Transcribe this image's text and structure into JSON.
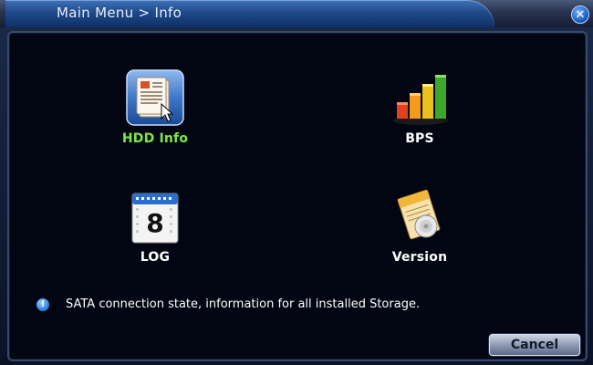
{
  "window": {
    "title": "Main Menu > Info",
    "close_icon": "close-icon"
  },
  "tiles": [
    {
      "label": "HDD Info",
      "icon": "hdd-info-icon",
      "selected": true
    },
    {
      "label": "BPS",
      "icon": "bar-chart-icon",
      "selected": false
    },
    {
      "label": "LOG",
      "icon": "calendar-log-icon",
      "selected": false
    },
    {
      "label": "Version",
      "icon": "version-document-icon",
      "selected": false
    }
  ],
  "info": {
    "icon": "info-icon",
    "text": "SATA connection state, information for all installed Storage."
  },
  "buttons": {
    "cancel": "Cancel"
  },
  "colors": {
    "selected_label": "#7ee84a",
    "title_bar": "#1f4a8a",
    "panel_bg": "#020512"
  }
}
